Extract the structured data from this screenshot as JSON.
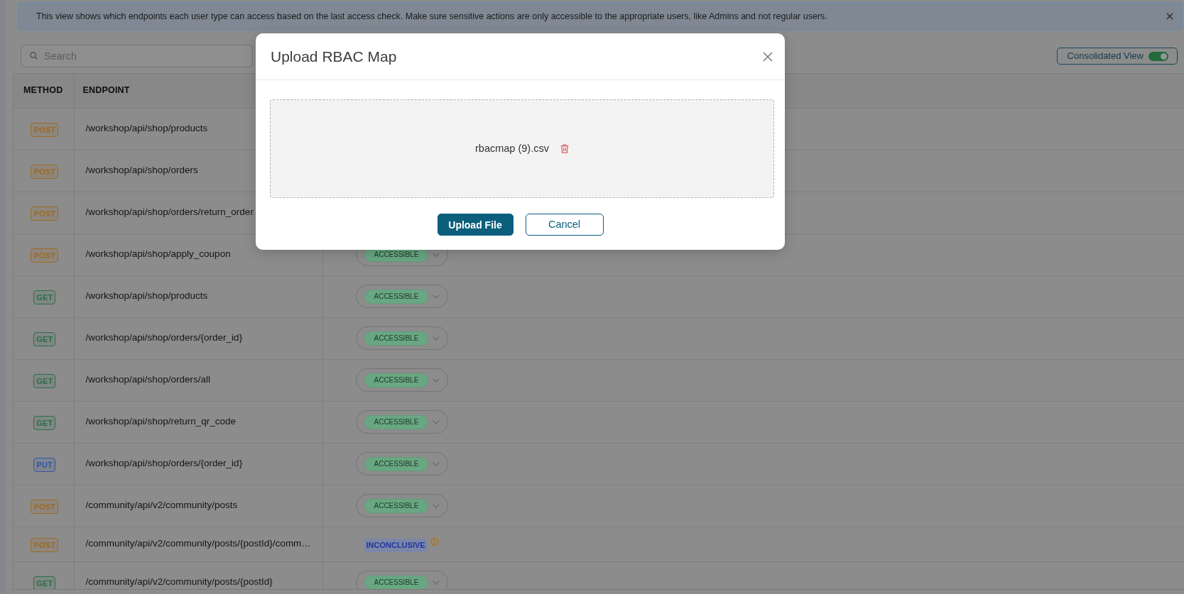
{
  "info_banner": {
    "text": "This view shows which endpoints each user type can access based on the last access check. Make sure sensitive actions are only accessible to the appropriate users, like Admins and not regular users."
  },
  "search": {
    "placeholder": "Search"
  },
  "view_toggle": {
    "label": "Consolidated View",
    "on": true
  },
  "table": {
    "columns": [
      "METHOD",
      "ENDPOINT"
    ],
    "rows": [
      {
        "method": {
          "label": "POST",
          "color": "#9a6a24"
        },
        "endpoint": "/workshop/api/shop/products"
      },
      {
        "method": {
          "label": "POST",
          "color": "#9a6a24"
        },
        "endpoint": "/workshop/api/shop/orders"
      },
      {
        "method": {
          "label": "POST",
          "color": "#9a6a24"
        },
        "endpoint": "/workshop/api/shop/orders/return_order"
      },
      {
        "method": {
          "label": "POST",
          "color": "#9a6a24"
        },
        "endpoint": "/workshop/api/shop/apply_coupon",
        "status": {
          "label": "ACCESSIBLE",
          "kind": "select"
        }
      },
      {
        "method": {
          "label": "GET",
          "color": "#2b6e4b"
        },
        "endpoint": "/workshop/api/shop/products",
        "status": {
          "label": "ACCESSIBLE",
          "kind": "select"
        }
      },
      {
        "method": {
          "label": "GET",
          "color": "#2b6e4b"
        },
        "endpoint": "/workshop/api/shop/orders/{order_id}",
        "status": {
          "label": "ACCESSIBLE",
          "kind": "select"
        }
      },
      {
        "method": {
          "label": "GET",
          "color": "#2b6e4b"
        },
        "endpoint": "/workshop/api/shop/orders/all",
        "status": {
          "label": "ACCESSIBLE",
          "kind": "select"
        }
      },
      {
        "method": {
          "label": "GET",
          "color": "#2b6e4b"
        },
        "endpoint": "/workshop/api/shop/return_qr_code",
        "status": {
          "label": "ACCESSIBLE",
          "kind": "select"
        }
      },
      {
        "method": {
          "label": "PUT",
          "color": "#2f56a6"
        },
        "endpoint": "/workshop/api/shop/orders/{order_id}",
        "status": {
          "label": "ACCESSIBLE",
          "kind": "select"
        }
      },
      {
        "method": {
          "label": "POST",
          "color": "#9a6a24"
        },
        "endpoint": "/community/api/v2/community/posts",
        "status": {
          "label": "ACCESSIBLE",
          "kind": "select"
        }
      },
      {
        "method": {
          "label": "POST",
          "color": "#9a6a24"
        },
        "endpoint": "/community/api/v2/community/posts/{postId}/comm…",
        "status": {
          "label": "INCONCLUSIVE",
          "kind": "warning"
        }
      },
      {
        "method": {
          "label": "GET",
          "color": "#2b6e4b"
        },
        "endpoint": "/community/api/v2/community/posts/{postId}",
        "status": {
          "label": "ACCESSIBLE",
          "kind": "select"
        }
      }
    ]
  },
  "upload_dialog": {
    "title": "Upload RBAC Map",
    "file_name": "rbacmap (9).csv",
    "buttons": [
      {
        "label": "Upload File",
        "kind": "primary"
      },
      {
        "label": "Cancel",
        "kind": "outline"
      }
    ]
  }
}
